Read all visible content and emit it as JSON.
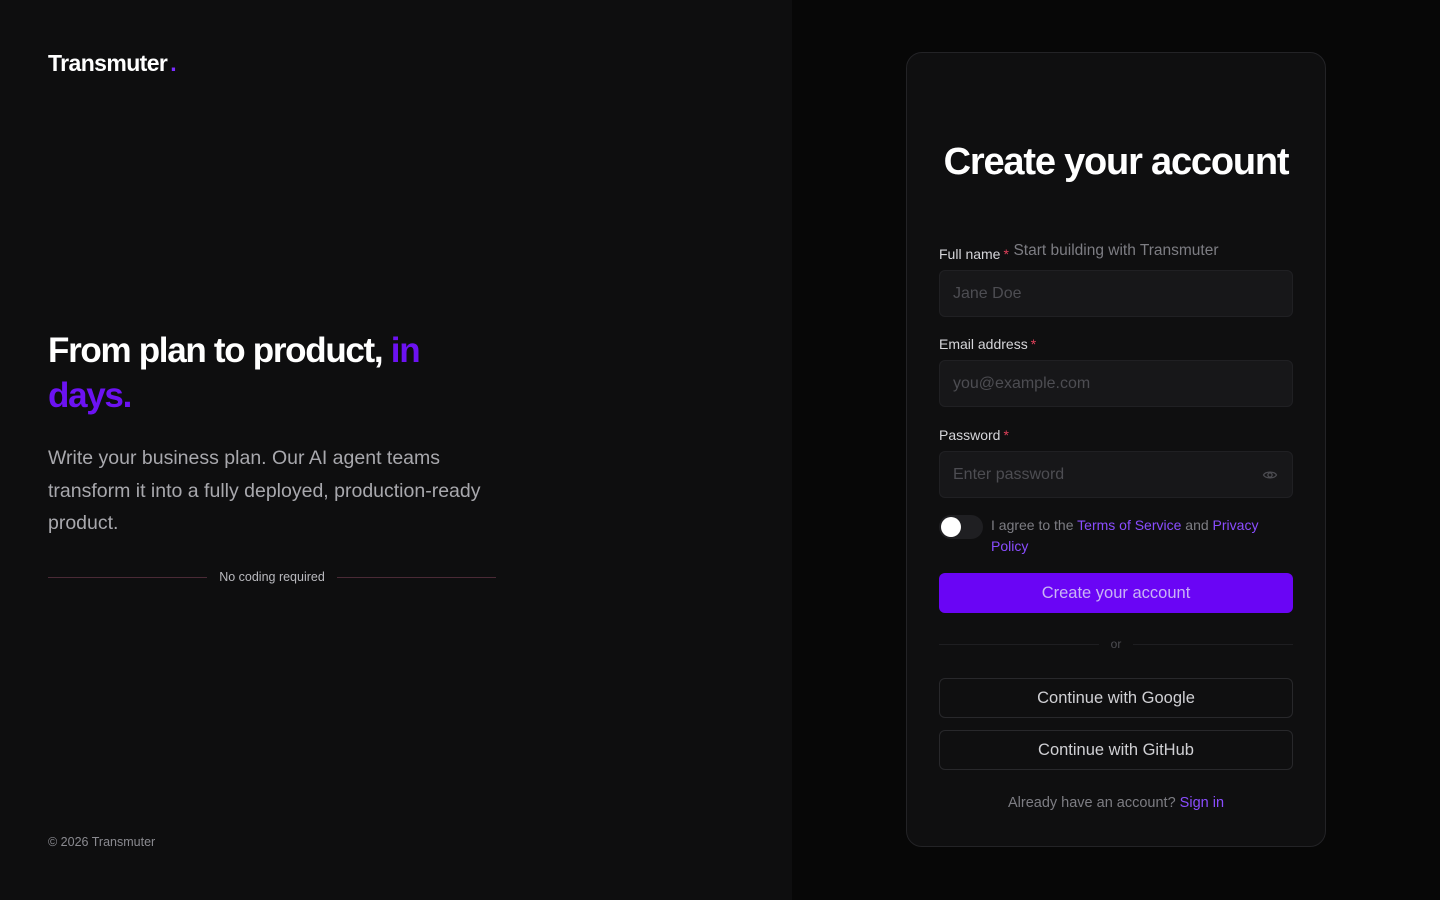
{
  "brand": {
    "name": "Transmuter",
    "dot": ".",
    "accent_color": "#6c12f2"
  },
  "hero": {
    "headline_main": "From plan to product,",
    "headline_accent": "in days.",
    "description": "Write your business plan. Our AI agent teams transform it into a fully deployed, production-ready product.",
    "divider_text": "No coding required"
  },
  "footer": {
    "copyright": "© 2026 Transmuter"
  },
  "form": {
    "title": "Create your account",
    "subtitle": "Start building with Transmuter",
    "required_mark": "*",
    "full_name": {
      "label": "Full name",
      "placeholder": "Jane Doe",
      "value": ""
    },
    "email": {
      "label": "Email address",
      "placeholder": "you@example.com",
      "value": ""
    },
    "password": {
      "label": "Password",
      "placeholder": "Enter password",
      "value": "",
      "visibility_icon": "eye-icon"
    },
    "agreement": {
      "prefix": "I agree to the",
      "terms_link": "Terms of Service",
      "connector": "and",
      "privacy_link": "Privacy Policy",
      "checked": false
    },
    "submit_label": "Create your account",
    "or_text": "or",
    "google_label": "Continue with Google",
    "github_label": "Continue with GitHub",
    "signin_prompt": "Already have an account?",
    "signin_link": "Sign in"
  }
}
